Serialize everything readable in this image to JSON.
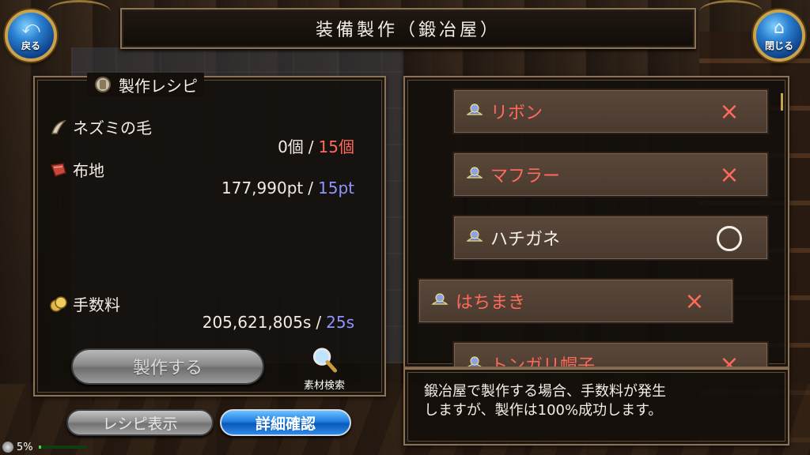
{
  "header": {
    "title": "装備製作（鍛冶屋）",
    "back_label": "戻る",
    "close_label": "閉じる"
  },
  "recipe": {
    "heading": "製作レシピ",
    "materials": [
      {
        "name": "ネズミの毛",
        "have": "0個",
        "need": "15個",
        "icon": "fur-icon"
      },
      {
        "name": "布地",
        "have": "177,990pt",
        "need": "15pt",
        "icon": "cloth-icon"
      }
    ],
    "fee": {
      "label": "手数料",
      "have": "205,621,805s",
      "need": "25s",
      "icon": "coin-icon"
    },
    "separator": "/",
    "craft_button": "製作する",
    "search_label": "素材検索"
  },
  "bottom_buttons": {
    "recipe_display": "レシピ表示",
    "detail_confirm": "詳細確認"
  },
  "status": {
    "percent_label": "5%",
    "progress": 0.05
  },
  "items": [
    {
      "name": "リボン",
      "mark": "×",
      "craftable": false
    },
    {
      "name": "マフラー",
      "mark": "×",
      "craftable": false
    },
    {
      "name": "ハチガネ",
      "mark": "○",
      "craftable": true
    },
    {
      "name": "はちまき",
      "mark": "×",
      "craftable": false
    },
    {
      "name": "トンガリ帽子",
      "mark": "×",
      "craftable": false
    }
  ],
  "message": {
    "line1": "鍛冶屋で製作する場合、手数料が発生",
    "line2": "しますが、製作は100%成功します。"
  },
  "colors": {
    "need_red": "#ff6a5a",
    "need_blue": "#8e96ff",
    "gold_frame": "#c9a24a"
  }
}
